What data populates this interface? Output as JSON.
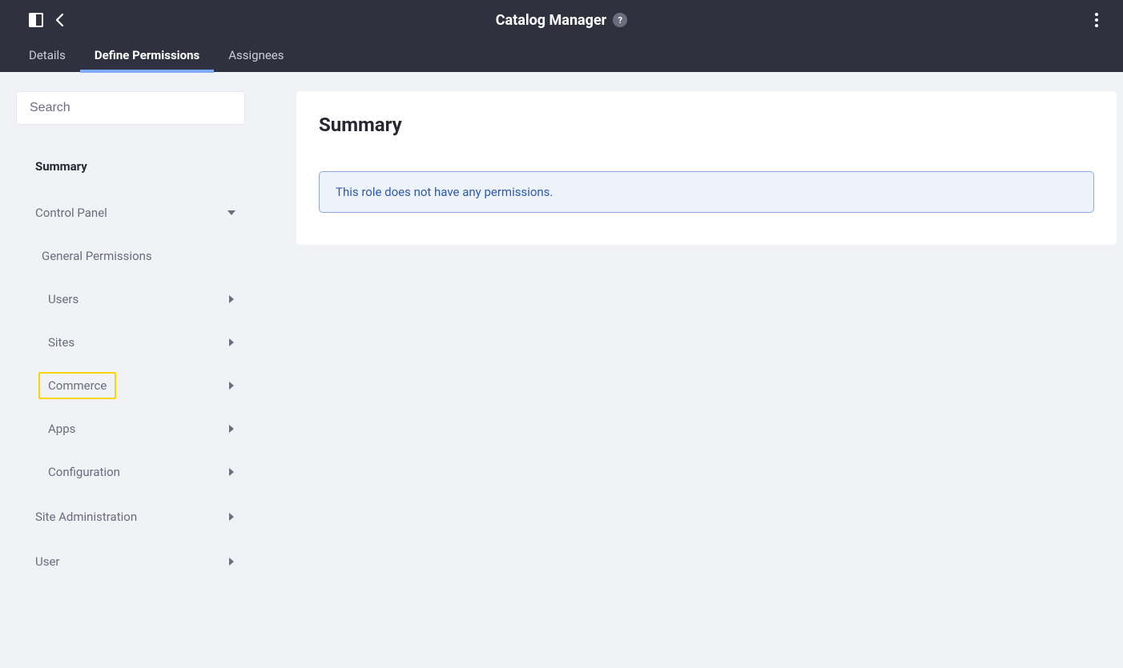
{
  "header": {
    "title": "Catalog Manager",
    "help_symbol": "?"
  },
  "tabs": {
    "details": "Details",
    "define_permissions": "Define Permissions",
    "assignees": "Assignees"
  },
  "search": {
    "placeholder": "Search"
  },
  "nav": {
    "summary": "Summary",
    "control_panel": "Control Panel",
    "general_permissions": "General Permissions",
    "users": "Users",
    "sites": "Sites",
    "commerce": "Commerce",
    "apps": "Apps",
    "configuration": "Configuration",
    "site_administration": "Site Administration",
    "user": "User"
  },
  "main": {
    "panel_title": "Summary",
    "empty_message": "This role does not have any permissions."
  }
}
